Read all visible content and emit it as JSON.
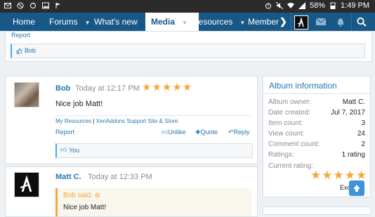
{
  "status_bar": {
    "battery": "58%",
    "time": "1:49 PM"
  },
  "nav": {
    "home": "Home",
    "forums": "Forums",
    "whats_new": "What's new",
    "media": "Media",
    "resources": "Resources",
    "members": "Member"
  },
  "top_block": {
    "report": "Report",
    "liker": "Bob"
  },
  "post1": {
    "username": "Bob",
    "time": "Today at 12:17 PM",
    "body": "Nice job Matt!",
    "signature_link1": "My Resources",
    "signature_sep": "|",
    "signature_link2": "XenAddons Support Site & Store",
    "report": "Report",
    "unlike": "Unlike",
    "quote": "Quote",
    "reply": "Reply",
    "liker": "You"
  },
  "post2": {
    "username": "Matt C.",
    "time": "Today at 12:33 PM",
    "quote_attr": "Bob said:",
    "quote_body": "Nice job Matt!"
  },
  "album_info": {
    "title": "Album information",
    "rows": [
      {
        "label": "Album owner:",
        "value": "Matt C."
      },
      {
        "label": "Date created:",
        "value": "Jul 7, 2017"
      },
      {
        "label": "Item count:",
        "value": "3"
      },
      {
        "label": "View count:",
        "value": "24"
      },
      {
        "label": "Comment count:",
        "value": "2"
      },
      {
        "label": "Ratings:",
        "value": "1 rating"
      },
      {
        "label": "Current rating:",
        "value": ""
      }
    ],
    "excerpt": "Exce"
  },
  "colors": {
    "nav_bg": "#185886",
    "link": "#2577b1",
    "star": "#f6a73a"
  },
  "icons": {
    "back_to_top": "arrow-up-icon",
    "search": "search-icon",
    "bell": "bell-icon",
    "mail": "mail-icon"
  }
}
